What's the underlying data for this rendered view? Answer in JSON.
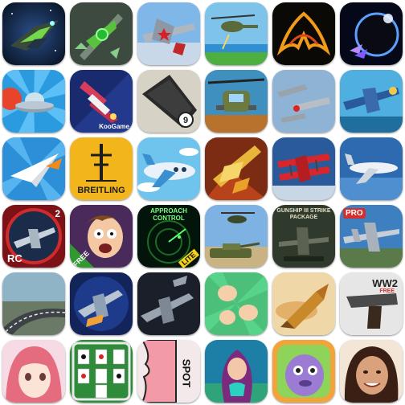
{
  "icons": [
    {
      "name": "space-fighter-icon"
    },
    {
      "name": "green-starship-icon"
    },
    {
      "name": "red-star-fighter-plane-icon"
    },
    {
      "name": "helicopter-over-sea-icon"
    },
    {
      "name": "flaming-batwing-ship-icon"
    },
    {
      "name": "planet-eclipse-shooter-icon"
    },
    {
      "name": "ufo-saucer-icon"
    },
    {
      "name": "koogame-jet-icon",
      "text": "KooGame"
    },
    {
      "name": "black-stealth-drone-icon"
    },
    {
      "name": "attack-helicopter-icon"
    },
    {
      "name": "ww2-fighter-squadron-icon"
    },
    {
      "name": "vintage-blue-plane-icon"
    },
    {
      "name": "paper-plane-icon"
    },
    {
      "name": "breitling-app-icon",
      "text": "BREITLING"
    },
    {
      "name": "cartoon-airliner-icon"
    },
    {
      "name": "golden-jet-icon"
    },
    {
      "name": "red-biplane-icon"
    },
    {
      "name": "business-jet-icon"
    },
    {
      "name": "rc-jet-2-icon",
      "text": "RC",
      "badge": "2"
    },
    {
      "name": "scared-cartoon-man-icon",
      "text": "FREE"
    },
    {
      "name": "approach-control-icon",
      "text": "APPROACH CONTROL",
      "badge": "LITE"
    },
    {
      "name": "army-tank-helicopter-icon"
    },
    {
      "name": "gunship-strike-package-icon",
      "text": "GUNSHIP III STRIKE PACKAGE"
    },
    {
      "name": "fighter-jet-pro-icon",
      "text": "PRO"
    },
    {
      "name": "race-track-icon"
    },
    {
      "name": "fighter-squadron-icon"
    },
    {
      "name": "grey-fighter-jets-icon"
    },
    {
      "name": "rock-paper-scissors-icon"
    },
    {
      "name": "flying-bullet-icon"
    },
    {
      "name": "ww2-pistol-icon",
      "text": "WW2",
      "badge": "FREE"
    },
    {
      "name": "anime-girl-icon"
    },
    {
      "name": "solitaire-cards-icon"
    },
    {
      "name": "spot-face-icon",
      "text": "SPOT"
    },
    {
      "name": "mermaid-icon"
    },
    {
      "name": "purple-monster-icon"
    },
    {
      "name": "smiling-woman-icon"
    }
  ],
  "colors": {
    "sky_blue": "#3ea6e8",
    "orange_burst": "#f08a1a",
    "breitling_yellow": "#f2b51c",
    "approach_green": "#1b6b24",
    "card_green": "#2e8b3a"
  }
}
